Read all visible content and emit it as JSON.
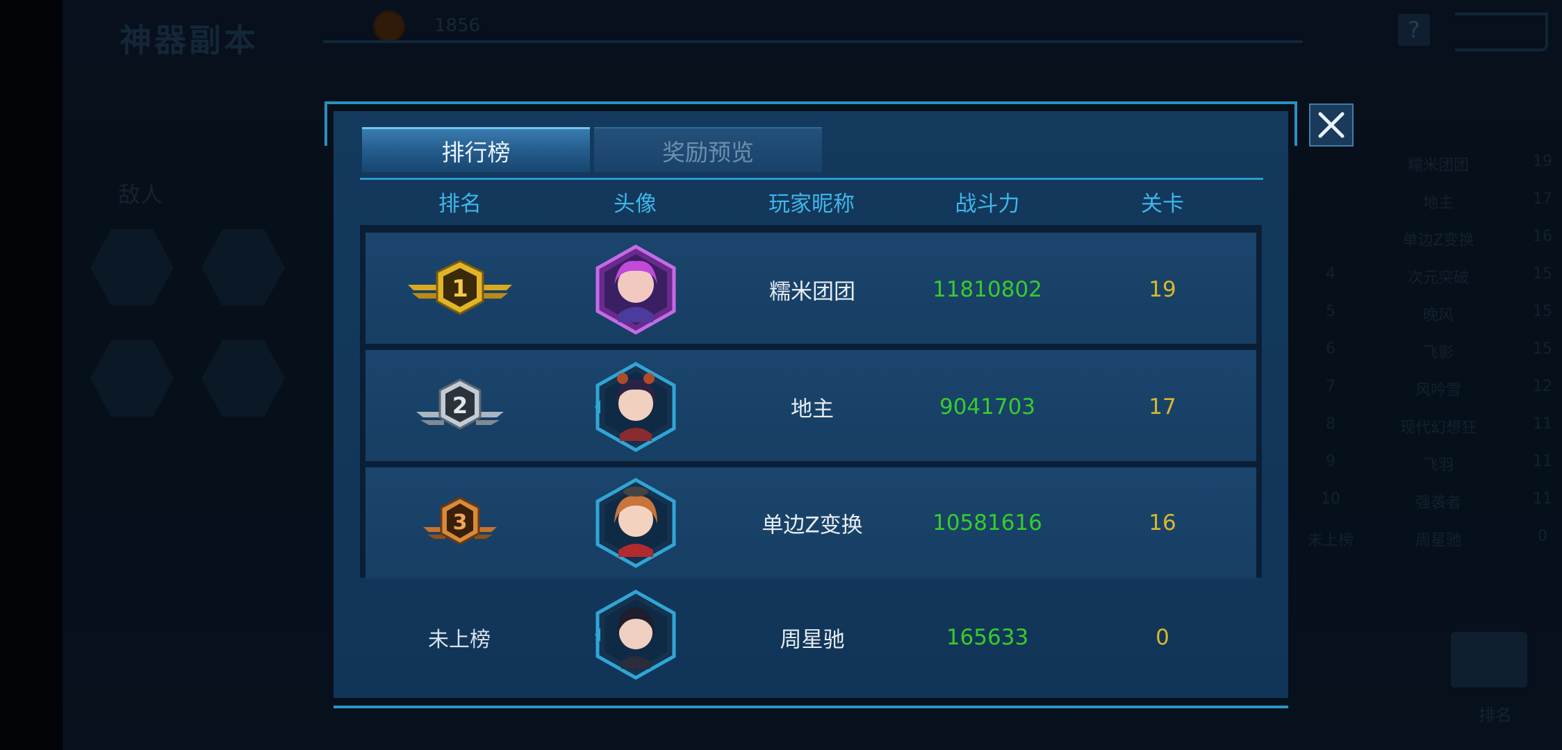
{
  "background": {
    "title": "神器副本",
    "coin_value": "1856",
    "help_label": "?",
    "enemy_label": "敌人",
    "side_ranking": [
      {
        "rank": "",
        "name": "糯米团团",
        "stage": "19"
      },
      {
        "rank": "",
        "name": "地主",
        "stage": "17"
      },
      {
        "rank": "",
        "name": "单边Z变换",
        "stage": "16"
      },
      {
        "rank": "4",
        "name": "次元突破",
        "stage": "15"
      },
      {
        "rank": "5",
        "name": "晚风",
        "stage": "15"
      },
      {
        "rank": "6",
        "name": "飞影",
        "stage": "15"
      },
      {
        "rank": "7",
        "name": "风吟雪",
        "stage": "12"
      },
      {
        "rank": "8",
        "name": "现代幻想狂",
        "stage": "11"
      },
      {
        "rank": "9",
        "name": "飞羽",
        "stage": "11"
      },
      {
        "rank": "10",
        "name": "强袭者",
        "stage": "11"
      },
      {
        "rank": "未上榜",
        "name": "周星驰",
        "stage": "0"
      }
    ],
    "podium_label": "排名"
  },
  "tabs": {
    "ranking": "排行榜",
    "rewards": "奖励预览"
  },
  "columns": {
    "rank": "排名",
    "avatar": "头像",
    "nickname": "玩家昵称",
    "power": "战斗力",
    "stage": "关卡"
  },
  "rows": [
    {
      "rank": 1,
      "nickname": "糯米团团",
      "power": "11810802",
      "stage": "19",
      "medal": "gold-medal-icon"
    },
    {
      "rank": 2,
      "nickname": "地主",
      "power": "9041703",
      "stage": "17",
      "medal": "silver-medal-icon"
    },
    {
      "rank": 3,
      "nickname": "单边Z变换",
      "power": "10581616",
      "stage": "16",
      "medal": "bronze-medal-icon"
    }
  ],
  "self_row": {
    "rank_text": "未上榜",
    "nickname": "周星驰",
    "power": "165633",
    "stage": "0"
  },
  "colors": {
    "header_text": "#3fb6e8",
    "power_text": "#37cc2c",
    "stage_text": "#d8b92c",
    "gold": "#d9a91e",
    "silver": "#aab6c2",
    "bronze": "#c7742c"
  }
}
